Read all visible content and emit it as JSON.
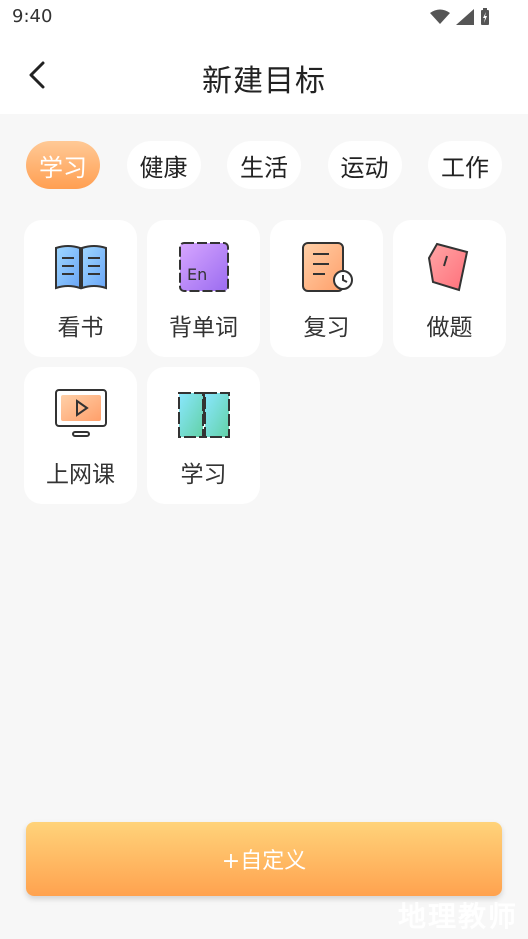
{
  "status": {
    "time": "9:40"
  },
  "header": {
    "title": "新建目标"
  },
  "tabs": [
    {
      "label": "学习",
      "active": true
    },
    {
      "label": "健康",
      "active": false
    },
    {
      "label": "生活",
      "active": false
    },
    {
      "label": "运动",
      "active": false
    },
    {
      "label": "工作",
      "active": false
    }
  ],
  "items": [
    {
      "label": "看书",
      "icon": "open-book-icon"
    },
    {
      "label": "背单词",
      "icon": "english-card-icon"
    },
    {
      "label": "复习",
      "icon": "notebook-clock-icon"
    },
    {
      "label": "做题",
      "icon": "pencil-tag-icon"
    },
    {
      "label": "上网课",
      "icon": "monitor-play-icon"
    },
    {
      "label": "学习",
      "icon": "study-book-icon"
    }
  ],
  "icons": {
    "en_text": "En"
  },
  "custom_button": {
    "label": "+自定义"
  },
  "watermark": {
    "text": "地理教师"
  },
  "colors": {
    "accent": "#ff9f52",
    "button_top": "#ffd37a",
    "button_bottom": "#ffa24f"
  }
}
